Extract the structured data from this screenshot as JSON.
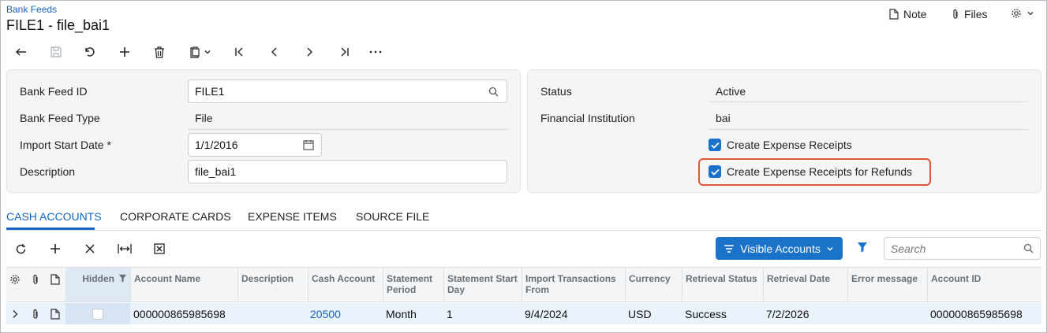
{
  "header": {
    "breadcrumb": "Bank Feeds",
    "title": "FILE1 - file_bai1",
    "note_label": "Note",
    "files_label": "Files"
  },
  "toolbar": {
    "icons": [
      "back-icon",
      "save-icon",
      "undo-icon",
      "add-icon",
      "delete-icon",
      "copy-paste-icon",
      "first-icon",
      "previous-icon",
      "next-icon",
      "last-icon",
      "more-icon"
    ]
  },
  "form_left": {
    "bank_feed_id_label": "Bank Feed ID",
    "bank_feed_id_value": "FILE1",
    "bank_feed_type_label": "Bank Feed Type",
    "bank_feed_type_value": "File",
    "import_start_date_label": "Import Start Date",
    "required_mark": "*",
    "import_start_date_value": "1/1/2016",
    "description_label": "Description",
    "description_value": "file_bai1"
  },
  "form_right": {
    "status_label": "Status",
    "status_value": "Active",
    "fi_label": "Financial Institution",
    "fi_value": "bai",
    "create_receipts_label": "Create Expense Receipts",
    "create_receipts_checked": true,
    "create_refunds_label": "Create Expense Receipts for Refunds",
    "create_refunds_checked": true
  },
  "tabs": [
    {
      "label": "CASH ACCOUNTS",
      "active": true
    },
    {
      "label": "CORPORATE CARDS",
      "active": false
    },
    {
      "label": "EXPENSE ITEMS",
      "active": false
    },
    {
      "label": "SOURCE FILE",
      "active": false
    }
  ],
  "grid_toolbar": {
    "visible_accounts_label": "Visible Accounts",
    "search_placeholder": "Search"
  },
  "grid": {
    "columns": {
      "hidden": "Hidden",
      "account_name": "Account Name",
      "description": "Description",
      "cash_account": "Cash Account",
      "statement_period": "Statement Period",
      "statement_start_day": "Statement Start Day",
      "import_from": "Import Transactions From",
      "currency": "Currency",
      "retrieval_status": "Retrieval Status",
      "retrieval_date": "Retrieval Date",
      "error_message": "Error message",
      "account_id": "Account ID"
    },
    "rows": [
      {
        "hidden": false,
        "account_name": "000000865985698",
        "description": "",
        "cash_account": "20500",
        "statement_period": "Month",
        "statement_start_day": "1",
        "import_from": "9/4/2024",
        "currency": "USD",
        "retrieval_status": "Success",
        "retrieval_date": "7/2/2026",
        "error_message": "",
        "account_id": "000000865985698"
      }
    ]
  },
  "colors": {
    "accent": "#1a73c8",
    "link": "#1565c0",
    "highlight": "#e2553a",
    "panel_bg": "#f4f5f7"
  }
}
